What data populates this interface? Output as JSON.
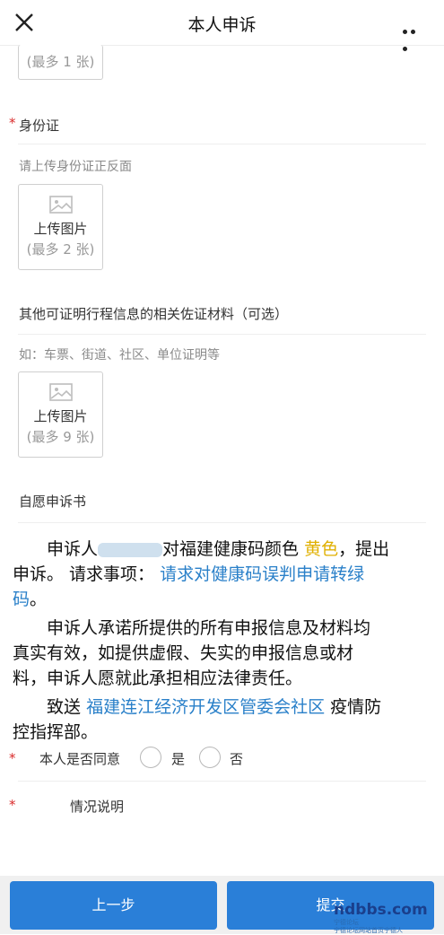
{
  "header": {
    "title": "本人申诉"
  },
  "upload_top": {
    "limit": "(最多 1 张)"
  },
  "id_card": {
    "required_mark": "*",
    "label": "身份证",
    "hint": "请上传身份证正反面",
    "upload_label": "上传图片",
    "upload_limit": "(最多 2 张)"
  },
  "other_materials": {
    "label": "其他可证明行程信息的相关佐证材料（可选）",
    "hint": "如：车票、街道、社区、单位证明等",
    "upload_label": "上传图片",
    "upload_limit": "(最多 9 张)"
  },
  "statement": {
    "label": "自愿申诉书",
    "p1_a": "申诉人",
    "p1_b": "对福建健康码颜色",
    "p1_color": "黄色",
    "p1_c": "，提出",
    "p1_d": "申诉。 请求事项：",
    "p1_request": "请求对健康码误判申请转绿",
    "p1_request2": "码",
    "p1_end": "。",
    "p2_l1": "申诉人承诺所提供的所有申报信息及材料均",
    "p2_l2": "真实有效，如提供虚假、失实的申报信息或材",
    "p2_l3": "料，申诉人愿就此承担相应法律责任。",
    "p3_a": "致送",
    "p3_org": "福建连江经济开发区管委会社区",
    "p3_b": "疫情防",
    "p3_c": "控指挥部。"
  },
  "consent": {
    "required_mark": "*",
    "label": "本人是否同意",
    "yes": "是",
    "no": "否"
  },
  "situation": {
    "required_mark": "*",
    "label": "情况说明"
  },
  "footer": {
    "prev_label": "上一步",
    "submit_label": "提交"
  },
  "watermark": {
    "brand": "ndbbs.com",
    "tag": "宁德论坛",
    "sub": "宁德论坛网站首页宁德人"
  }
}
